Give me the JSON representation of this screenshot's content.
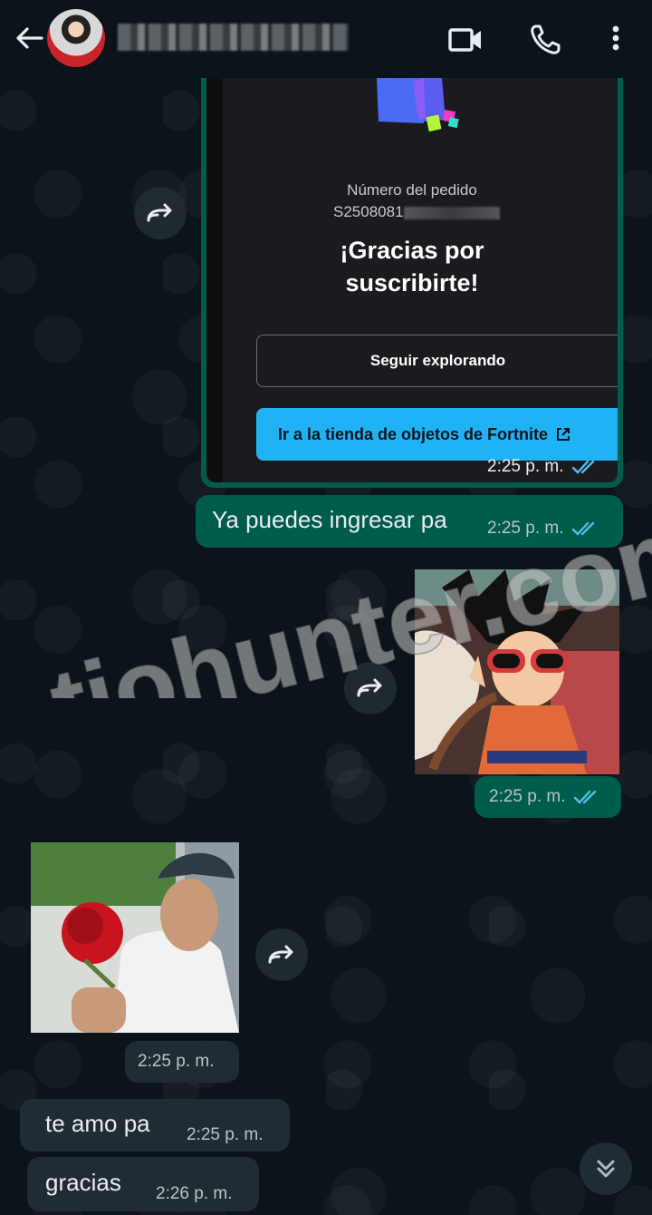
{
  "header": {
    "contact_name": "",
    "icons": [
      "arrow-left-icon",
      "video-call-icon",
      "phone-icon",
      "more-vert-icon"
    ]
  },
  "messages": [
    {
      "type": "card",
      "direction": "outgoing",
      "order_label": "Número del pedido",
      "order_number": "S2508081",
      "thanks": "¡Gracias por suscribirte!",
      "explore_button": "Seguir explorando",
      "store_button": "Ir a la tienda de objetos de Fortnite",
      "time": "2:25 p. m."
    },
    {
      "type": "text",
      "direction": "outgoing",
      "text": "Ya puedes ingresar pa",
      "time": "2:25 p. m."
    },
    {
      "type": "image",
      "direction": "outgoing",
      "time": "2:25 p. m."
    },
    {
      "type": "image",
      "direction": "incoming",
      "time": "2:25 p. m."
    },
    {
      "type": "text",
      "direction": "incoming",
      "text": "te amo pa",
      "time": "2:25 p. m."
    },
    {
      "type": "text",
      "direction": "incoming",
      "text": "gracias",
      "time": "2:26 p. m."
    }
  ],
  "watermark": "tiohunter.com",
  "colors": {
    "background": "#0b141a",
    "outgoing_bubble": "#005c4b",
    "incoming_bubble": "#202c33",
    "read_ticks": "#53bdeb",
    "fortnite_button": "#1fb2f5"
  }
}
